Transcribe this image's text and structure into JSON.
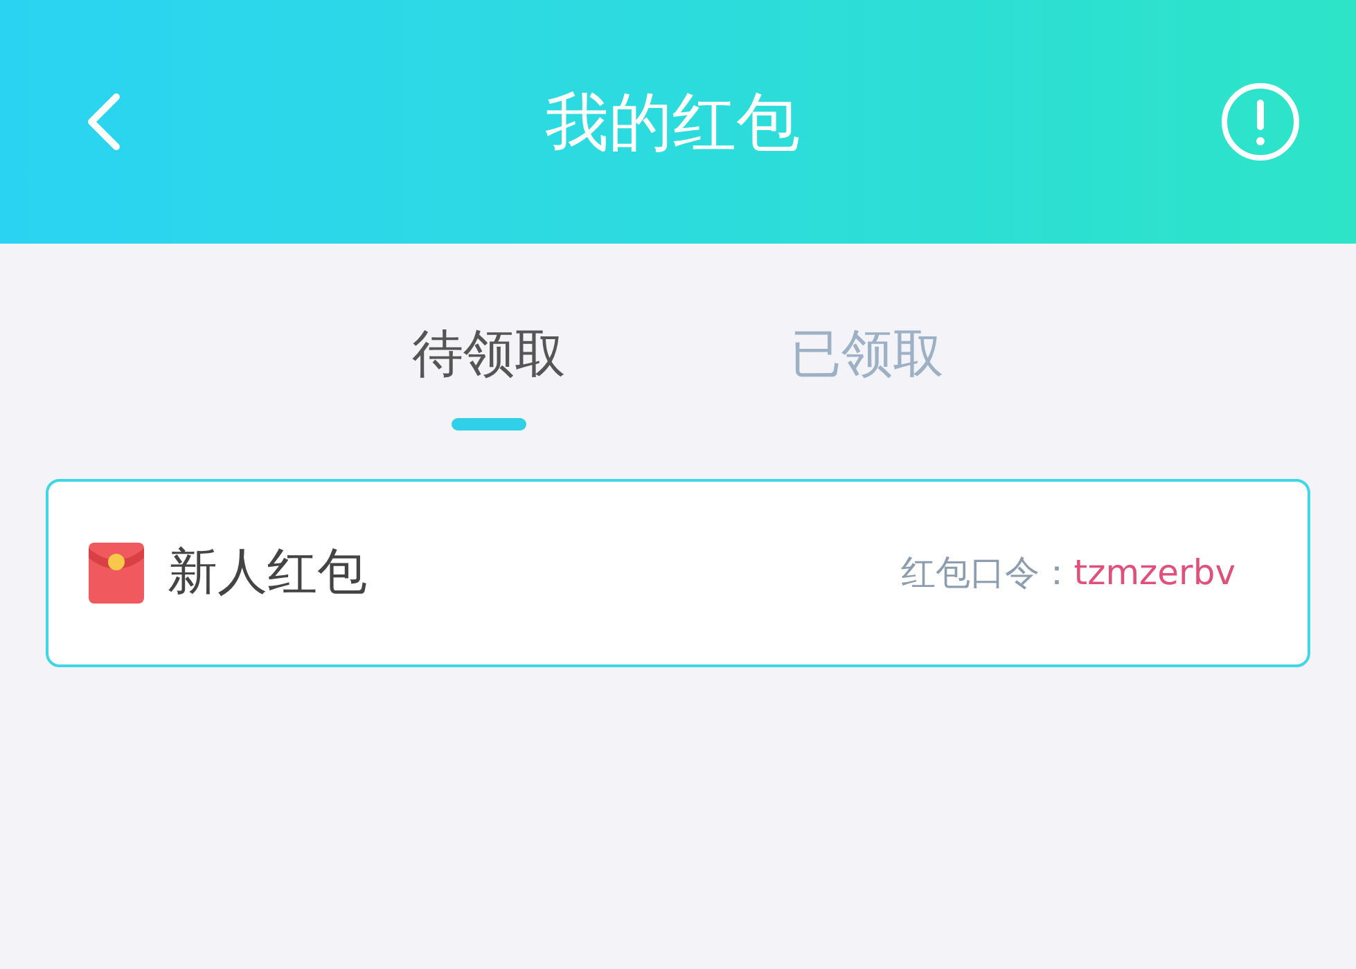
{
  "header": {
    "title": "我的红包"
  },
  "tabs": [
    {
      "label": "待领取",
      "selected": true
    },
    {
      "label": "已领取",
      "selected": false
    }
  ],
  "packets": [
    {
      "name": "新人红包",
      "code_label": "红包口令：",
      "code": "tzmzerbv"
    }
  ]
}
